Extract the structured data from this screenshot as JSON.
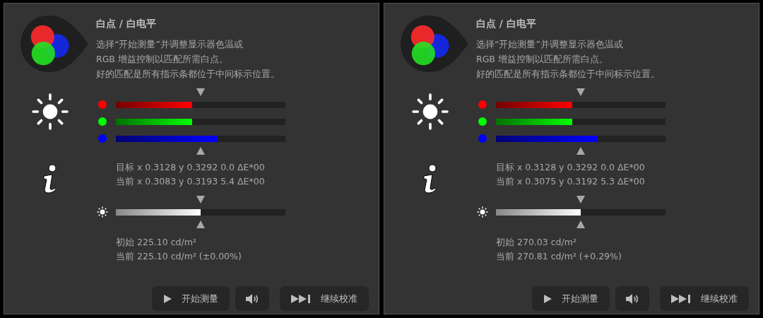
{
  "panels": [
    {
      "title": "白点 / 白电平",
      "description": [
        "选择“开始测量”并调整显示器色温或",
        "RGB 增益控制以匹配所需白点。",
        "好的匹配是所有指示条都位于中间标示位置。"
      ],
      "channels": [
        {
          "color": "#ff0000",
          "level": 0.45
        },
        {
          "color": "#00ff00",
          "level": 0.45
        },
        {
          "color": "#0000ff",
          "level": 0.6
        }
      ],
      "chromaticity": [
        "目标 x 0.3128 y 0.3292 0.0 ΔE*00",
        "当前 x 0.3083 y 0.3193 5.4 ΔE*00"
      ],
      "luminance": {
        "level": 0.5
      },
      "luminance_info": [
        "初始 225.10 cd/m²",
        "当前 225.10 cd/m² (±0.00%)"
      ],
      "buttons": [
        {
          "kind": "play",
          "label": "开始测量"
        },
        {
          "kind": "sound"
        },
        {
          "kind": "skip",
          "label": "继续校准"
        }
      ]
    },
    {
      "title": "白点 / 白电平",
      "description": [
        "选择“开始测量”并调整显示器色温或",
        "RGB 增益控制以匹配所需白点。",
        "好的匹配是所有指示条都位于中间标示位置。"
      ],
      "channels": [
        {
          "color": "#ff0000",
          "level": 0.45
        },
        {
          "color": "#00ff00",
          "level": 0.45
        },
        {
          "color": "#0000ff",
          "level": 0.6
        }
      ],
      "chromaticity": [
        "目标 x 0.3128 y 0.3292 0.0 ΔE*00",
        "当前 x 0.3075 y 0.3192 5.3 ΔE*00"
      ],
      "luminance": {
        "level": 0.5
      },
      "luminance_info": [
        "初始 270.03 cd/m²",
        "当前 270.81 cd/m² (+0.29%)"
      ],
      "buttons": [
        {
          "kind": "play",
          "label": "开始测量"
        },
        {
          "kind": "sound"
        },
        {
          "kind": "skip",
          "label": "继续校准"
        }
      ]
    }
  ]
}
